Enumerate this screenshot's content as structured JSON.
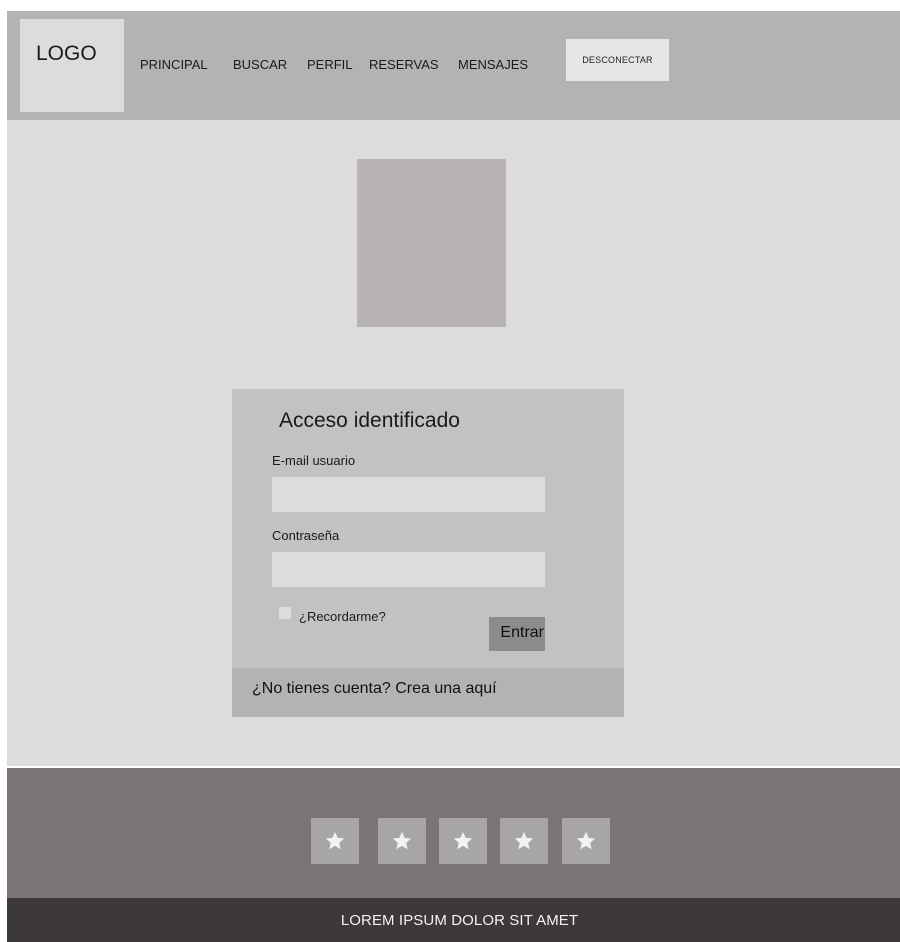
{
  "header": {
    "logo": "LOGO",
    "nav": [
      "PRINCIPAL",
      "BUSCAR",
      "PERFIL",
      "RESERVAS",
      "MENSAJES"
    ],
    "logout_label": "DESCONECTAR"
  },
  "login": {
    "title": "Acceso identificado",
    "email_label": "E-mail usuario",
    "email_value": "",
    "password_label": "Contraseña",
    "password_value": "",
    "remember_label": "¿Recordarme?",
    "remember_checked": false,
    "submit_label": "Entrar",
    "signup_text": "¿No tienes cuenta? Crea una aquí"
  },
  "footer": {
    "stars": [
      "star-icon",
      "star-icon",
      "star-icon",
      "star-icon",
      "star-icon"
    ],
    "text": "LOREM IPSUM DOLOR SIT AMET"
  },
  "colors": {
    "header_bg": "#b3b3b3",
    "page_bg": "#dcdcdc",
    "footer_bg": "#7a7574",
    "bottom_bar_bg": "#3d3938"
  }
}
